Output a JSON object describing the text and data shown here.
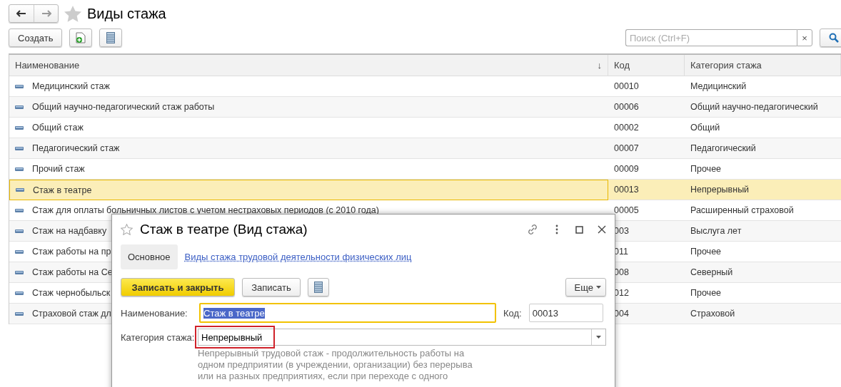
{
  "title": "Виды стажа",
  "toolbar": {
    "create": "Создать",
    "search": {
      "placeholder": "Поиск (Ctrl+F)",
      "clear": "×"
    }
  },
  "table": {
    "columns": [
      {
        "label": "Наименование",
        "sort": "↓"
      },
      {
        "label": "Код"
      },
      {
        "label": "Категория стажа"
      }
    ],
    "rows": [
      {
        "name": "Медицинский стаж",
        "code": "00010",
        "category": "Медицинский",
        "selected": false
      },
      {
        "name": "Общий научно-педагогический стаж работы",
        "code": "00006",
        "category": "Общий научно-педагогический",
        "selected": false
      },
      {
        "name": "Общий стаж",
        "code": "00002",
        "category": "Общий",
        "selected": false
      },
      {
        "name": "Педагогический стаж",
        "code": "00007",
        "category": "Педагогический",
        "selected": false
      },
      {
        "name": "Прочий стаж",
        "code": "00009",
        "category": "Прочее",
        "selected": false
      },
      {
        "name": "Стаж в театре",
        "code": "00013",
        "category": "Непрерывный",
        "selected": true
      },
      {
        "name": "Стаж для оплаты больничных листов с учетом нестраховых периодов (с 2010 года)",
        "code": "00005",
        "category": "Расширенный страховой",
        "selected": false
      },
      {
        "name": "Стаж на надбавку",
        "code": "003",
        "category": "Выслуга лет",
        "selected": false
      },
      {
        "name": "Стаж работы на пр",
        "code": "011",
        "category": "Прочее",
        "selected": false
      },
      {
        "name": "Стаж работы на Се",
        "code": "008",
        "category": "Северный",
        "selected": false
      },
      {
        "name": "Стаж чернобыльск",
        "code": "012",
        "category": "Прочее",
        "selected": false
      },
      {
        "name": "Страховой стаж дл",
        "code": "004",
        "category": "Страховой",
        "selected": false
      }
    ]
  },
  "dialog": {
    "title": "Стаж в театре (Вид стажа)",
    "tabs": [
      {
        "label": "Основное",
        "selected": true,
        "kind": "tab"
      },
      {
        "label": "Виды стажа трудовой деятельности физических лиц",
        "selected": false,
        "kind": "link"
      }
    ],
    "buttons": {
      "save_close": "Записать и закрыть",
      "save": "Записать",
      "more": "Еще"
    },
    "name_label": "Наименование:",
    "name_value": "Стаж в театре",
    "code_label": "Код:",
    "code_value": "00013",
    "category_label": "Категория стажа:",
    "category_value": "Непрерывный",
    "description": [
      "Непрерывный трудовой стаж - продолжительность работы на",
      "одном предприятии (в учреждении, организации) без перерыва",
      "или на разных предприятиях, если при переходе с одного"
    ]
  }
}
